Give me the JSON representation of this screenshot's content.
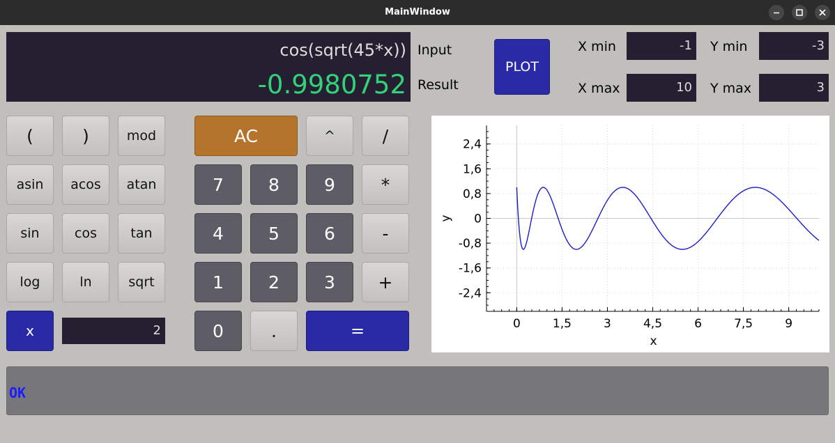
{
  "window": {
    "title": "MainWindow",
    "controls": [
      "minimize-icon",
      "maximize-icon",
      "close-icon"
    ]
  },
  "display": {
    "input": "cos(sqrt(45*x))",
    "result": "-0.9980752"
  },
  "labels": {
    "input": "Input",
    "result": "Result"
  },
  "plot_button": "PLOT",
  "range": {
    "x_min_label": "X min",
    "x_min_value": "-1",
    "x_max_label": "X max",
    "x_max_value": "10",
    "y_min_label": "Y min",
    "y_min_value": "-3",
    "y_max_label": "Y max",
    "y_max_value": "3"
  },
  "keys": {
    "lparen": "(",
    "rparen": ")",
    "mod": "mod",
    "asin": "asin",
    "acos": "acos",
    "atan": "atan",
    "sin": "sin",
    "cos": "cos",
    "tan": "tan",
    "log": "log",
    "ln": "ln",
    "sqrt": "sqrt",
    "x": "x",
    "ac": "AC",
    "pow": "^",
    "div": "/",
    "mul": "*",
    "sub": "-",
    "add": "+",
    "n7": "7",
    "n8": "8",
    "n9": "9",
    "n4": "4",
    "n5": "5",
    "n6": "6",
    "n1": "1",
    "n2": "2",
    "n3": "3",
    "n0": "0",
    "dot": ".",
    "eq": "="
  },
  "x_value": "2",
  "status": "OK",
  "colors": {
    "display_bg": "#241f31",
    "result_text": "#33d17a",
    "blue_button": "#2a2aa6",
    "ac_button": "#b5742b",
    "digit_button": "#5e5c64",
    "status_text": "#1c1cff",
    "curve": "#1c1cc8"
  },
  "chart_data": {
    "type": "line",
    "expression": "cos(sqrt(45*x))",
    "xlabel": "x",
    "ylabel": "y",
    "xlim": [
      -1,
      10
    ],
    "ylim": [
      -3,
      3
    ],
    "x_ticks": [
      "0",
      "1,5",
      "3",
      "4,5",
      "6",
      "7,5",
      "9"
    ],
    "y_ticks": [
      "2,4",
      "1,6",
      "0,8",
      "0",
      "-0,8",
      "-1,6",
      "-2,4"
    ],
    "grid": true,
    "x_sample_step": 0.01
  }
}
